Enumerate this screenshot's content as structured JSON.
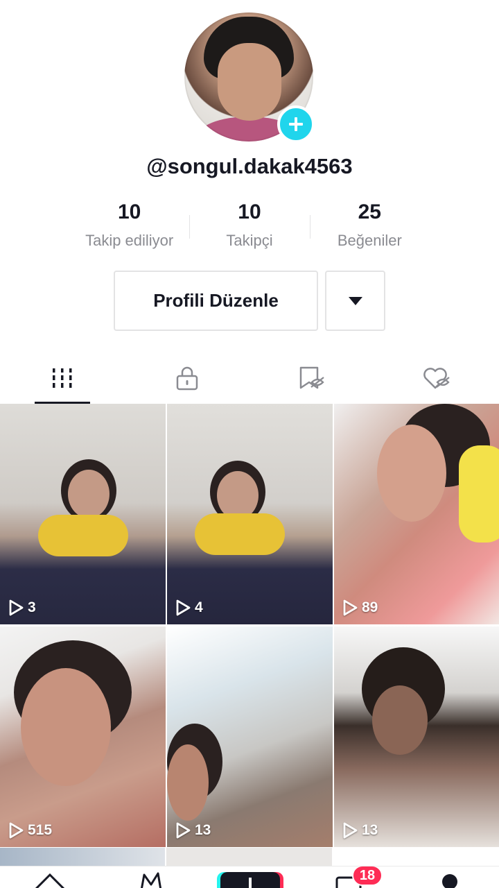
{
  "profile": {
    "username": "@songul.dakak4563"
  },
  "stats": [
    {
      "value": "10",
      "label": "Takip ediliyor"
    },
    {
      "value": "10",
      "label": "Takipçi"
    },
    {
      "value": "25",
      "label": "Beğeniler"
    }
  ],
  "actions": {
    "edit_label": "Profili Düzenle"
  },
  "tabs": [
    {
      "icon": "grid-icon",
      "active": true
    },
    {
      "icon": "lock-icon",
      "active": false
    },
    {
      "icon": "bookmark-hidden-icon",
      "active": false
    },
    {
      "icon": "heart-hidden-icon",
      "active": false
    }
  ],
  "videos": [
    {
      "views": "3"
    },
    {
      "views": "4"
    },
    {
      "views": "89"
    },
    {
      "views": "515"
    },
    {
      "views": "13"
    },
    {
      "views": "13"
    }
  ],
  "nav": {
    "inbox_badge": "18"
  },
  "colors": {
    "accent_cyan": "#20d5ec",
    "badge_red": "#fe2c55",
    "text_primary": "#161823",
    "text_secondary": "#8a8b91"
  }
}
